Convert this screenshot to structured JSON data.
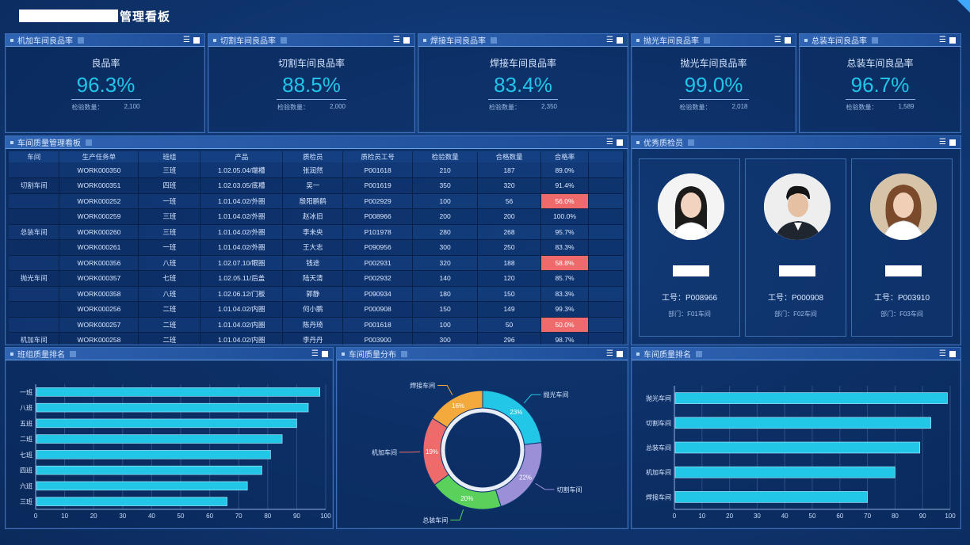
{
  "header": {
    "title": "管理看板"
  },
  "kpis": [
    {
      "panel_title": "机加车间良品率",
      "label": "良品率",
      "value": "96.3%",
      "sub_label": "检验数量：",
      "sub_value": "2,100"
    },
    {
      "panel_title": "切割车间良品率",
      "label": "切割车间良品率",
      "value": "88.5%",
      "sub_label": "检验数量：",
      "sub_value": "2,000"
    },
    {
      "panel_title": "焊接车间良品率",
      "label": "焊接车间良品率",
      "value": "83.4%",
      "sub_label": "检验数量：",
      "sub_value": "2,350"
    },
    {
      "panel_title": "抛光车间良品率",
      "label": "抛光车间良品率",
      "value": "99.0%",
      "sub_label": "检验数量：",
      "sub_value": "2,018"
    },
    {
      "panel_title": "总装车间良品率",
      "label": "总装车间良品率",
      "value": "96.7%",
      "sub_label": "检验数量：",
      "sub_value": "1,589"
    }
  ],
  "quality_table": {
    "panel_title": "车间质量管理看板",
    "columns": [
      "车间",
      "生产任务单",
      "班组",
      "产品",
      "质检员",
      "质检员工号",
      "检验数量",
      "合格数量",
      "合格率"
    ],
    "workshop_labels": [
      {
        "name": "切割车间",
        "row": 1
      },
      {
        "name": "总装车间",
        "row": 4
      },
      {
        "name": "抛光车间",
        "row": 7
      },
      {
        "name": "机加车间",
        "row": 11
      }
    ],
    "rows": [
      [
        "WORK000350",
        "三班",
        "1.02.05.04/端槽",
        "张润然",
        "P001618",
        "210",
        "187",
        "89.0%",
        false
      ],
      [
        "WORK000351",
        "四班",
        "1.02.03.05/底槽",
        "吴一",
        "P001619",
        "350",
        "320",
        "91.4%",
        false
      ],
      [
        "WORK000252",
        "一班",
        "1.01.04.02/外圈",
        "殷阳鹏鹤",
        "P002929",
        "100",
        "56",
        "56.0%",
        true
      ],
      [
        "WORK000259",
        "三班",
        "1.01.04.02/外圈",
        "赵冰旧",
        "P008966",
        "200",
        "200",
        "100.0%",
        false
      ],
      [
        "WORK000260",
        "三班",
        "1.01.04.02/外圈",
        "李未央",
        "P101978",
        "280",
        "268",
        "95.7%",
        false
      ],
      [
        "WORK000261",
        "一班",
        "1.01.04.02/外圈",
        "王大志",
        "P090956",
        "300",
        "250",
        "83.3%",
        false
      ],
      [
        "WORK000356",
        "八班",
        "1.02.07.10/眼圈",
        "钱途",
        "P002931",
        "320",
        "188",
        "58.8%",
        true
      ],
      [
        "WORK000357",
        "七班",
        "1.02.05.11/后盖",
        "陆天清",
        "P002932",
        "140",
        "120",
        "85.7%",
        false
      ],
      [
        "WORK000358",
        "八班",
        "1.02.06.12/门板",
        "郭静",
        "P090934",
        "180",
        "150",
        "83.3%",
        false
      ],
      [
        "WORK000256",
        "二班",
        "1.01.04.02/内圈",
        "何小鹏",
        "P000908",
        "150",
        "149",
        "99.3%",
        false
      ],
      [
        "WORK000257",
        "二班",
        "1.01.04.02/内圈",
        "陈丹琦",
        "P001618",
        "100",
        "50",
        "50.0%",
        true
      ],
      [
        "WORK000258",
        "二班",
        "1.01.04.02/内圈",
        "李丹丹",
        "P003900",
        "300",
        "296",
        "98.7%",
        false
      ]
    ]
  },
  "inspectors": {
    "panel_title": "优秀质检员",
    "people": [
      {
        "id": "工号：P008966",
        "dept": "部门：F01车间"
      },
      {
        "id": "工号：P000908",
        "dept": "部门：F02车间"
      },
      {
        "id": "工号：P003910",
        "dept": "部门：F03车间"
      }
    ]
  },
  "panels": {
    "team_rank": "班组质量排名",
    "distribution": "车间质量分布",
    "workshop_rank": "车间质量排名"
  },
  "chart_data": [
    {
      "type": "bar",
      "orientation": "horizontal",
      "categories": [
        "一班",
        "八班",
        "五班",
        "二班",
        "七班",
        "四班",
        "六班",
        "三班"
      ],
      "values": [
        98,
        94,
        90,
        85,
        81,
        78,
        73,
        66
      ],
      "xlim": [
        0,
        100
      ],
      "xticks": [
        0,
        10,
        20,
        30,
        40,
        50,
        60,
        70,
        80,
        90,
        100
      ],
      "bar_color": "#22c6e6",
      "grid": true
    },
    {
      "type": "pie",
      "donut": true,
      "labels": [
        "抛光车间",
        "切割车间",
        "总装车间",
        "机加车间",
        "焊接车间"
      ],
      "values": [
        23,
        22,
        20,
        19,
        16
      ],
      "value_labels": [
        "23%",
        "22%",
        "20%",
        "19%",
        "16%"
      ],
      "colors": [
        "#22c6e6",
        "#9b8fd8",
        "#5ad15a",
        "#ef6b6b",
        "#f4a93c"
      ]
    },
    {
      "type": "bar",
      "orientation": "horizontal",
      "categories": [
        "抛光车间",
        "切割车间",
        "总装车间",
        "机加车间",
        "焊接车间"
      ],
      "values": [
        99,
        93,
        89,
        80,
        70
      ],
      "xlim": [
        0,
        100
      ],
      "xticks": [
        0,
        10,
        20,
        30,
        40,
        50,
        60,
        70,
        80,
        90,
        100
      ],
      "bar_color": "#22c6e6",
      "grid": true
    }
  ]
}
